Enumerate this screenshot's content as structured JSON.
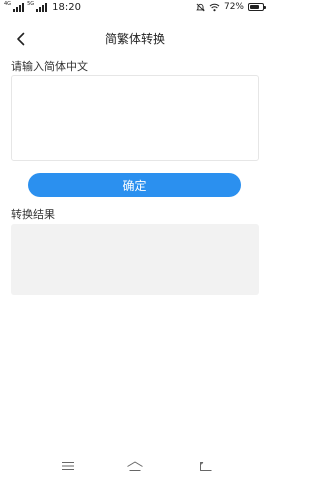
{
  "status_bar": {
    "network_1": "4G",
    "network_2": "5G",
    "time": "18:20",
    "battery_percent": "72%",
    "battery_level": 0.72,
    "icons": [
      "signal-icon",
      "mute-icon",
      "wifi-icon",
      "battery-icon"
    ]
  },
  "header": {
    "title": "简繁体转换",
    "back_icon": "chevron-left-icon"
  },
  "input_section": {
    "label": "请输入简体中文",
    "value": "",
    "placeholder": ""
  },
  "confirm_button": {
    "label": "确定",
    "color": "#2b90ef"
  },
  "result_section": {
    "label": "转换结果",
    "value": ""
  },
  "nav_bar": {
    "icons": [
      "menu-icon",
      "home-icon",
      "back-icon"
    ]
  }
}
